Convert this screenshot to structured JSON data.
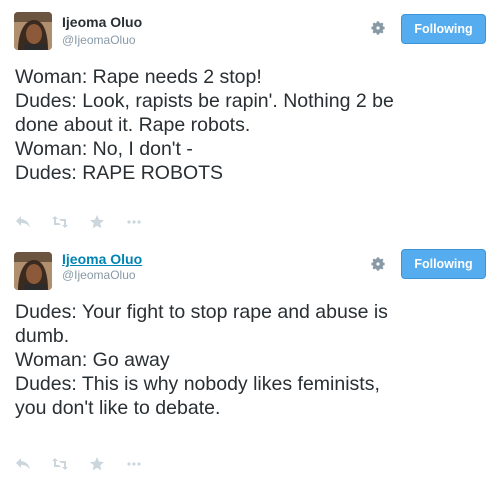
{
  "tweets": [
    {
      "author_name": "Ijeoma Oluo",
      "author_handle": "@IjeomaOluo",
      "follow_label": "Following",
      "text_lines": [
        "Woman: Rape needs 2 stop!",
        "Dudes: Look, rapists be rapin'. Nothing 2 be",
        "done about it. Rape robots.",
        "Woman: No, I don't -",
        "Dudes: RAPE ROBOTS"
      ]
    },
    {
      "author_name": "Ijeoma Oluo",
      "author_handle": "@IjeomaOluo",
      "follow_label": "Following",
      "text_lines": [
        "Dudes: Your fight to stop rape and abuse is",
        "dumb.",
        "Woman: Go away",
        "Dudes: This is why nobody likes feminists,",
        "you don't like to debate."
      ]
    }
  ],
  "icons": {
    "settings": "gear-icon",
    "reply": "reply-icon",
    "retweet": "retweet-icon",
    "favorite": "star-icon",
    "more": "more-icon"
  },
  "colors": {
    "follow_button": "#55acee",
    "name_link": "#0084b4",
    "handle": "#8899a6",
    "action_icon": "#ccd6dd"
  }
}
